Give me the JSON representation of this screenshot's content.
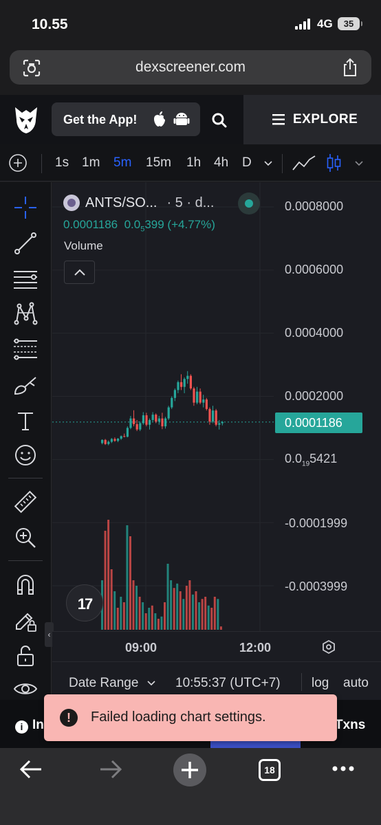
{
  "status_bar": {
    "time": "10.55",
    "network": "4G",
    "battery": "35"
  },
  "browser": {
    "url": "dexscreener.com",
    "tab_count": "18"
  },
  "header": {
    "get_app_label": "Get the App!",
    "explore_label": "EXPLORE"
  },
  "timeframes": {
    "items": [
      "1s",
      "1m",
      "5m",
      "15m",
      "1h",
      "4h",
      "D"
    ],
    "active": "5m"
  },
  "chart": {
    "pair": "ANTS/SO...",
    "meta": "· 5 · d...",
    "last_price": "0.0001186",
    "change_prefix": "0.0",
    "change_sub": "5",
    "change_rest": "399 (+4.77%)",
    "volume_label": "Volume",
    "price_axis": [
      "0.0008000",
      "0.0006000",
      "0.0004000",
      "0.0002000"
    ],
    "current_price_tag": "0.0001186",
    "low_prefix": "0.0",
    "low_sub": "19",
    "low_rest": "5421",
    "neg_axis": [
      "-0.0001999",
      "-0.0003999"
    ],
    "time_labels": [
      "09:00",
      "12:00"
    ],
    "colors": {
      "up": "#26a69a",
      "down": "#ef5350",
      "accent": "#2962ff"
    }
  },
  "bottom_bar": {
    "date_range": "Date Range",
    "clock": "10:55:37 (UTC+7)",
    "log": "log",
    "auto": "auto"
  },
  "info_strip": {
    "left": "In",
    "right": "Txns"
  },
  "toast": {
    "message": "Failed loading chart settings."
  },
  "chart_data": {
    "type": "candlestick",
    "interval": "5m",
    "ylim": [
      -0.0004,
      0.0008
    ],
    "last": 0.0001186,
    "candles": [
      [
        5.2e-05,
        6.4e-05,
        4.8e-05,
        6.2e-05
      ],
      [
        6.2e-05,
        6.5e-05,
        4.6e-05,
        4.9e-05
      ],
      [
        4.9e-05,
        6e-05,
        4.5e-05,
        5.6e-05
      ],
      [
        5.6e-05,
        6.8e-05,
        5.2e-05,
        6.5e-05
      ],
      [
        6.5e-05,
        7e-05,
        5.6e-05,
        5.9e-05
      ],
      [
        5.9e-05,
        6.8e-05,
        5.5e-05,
        6.6e-05
      ],
      [
        6.6e-05,
        7.6e-05,
        6.2e-05,
        7.4e-05
      ],
      [
        7.4e-05,
        8.2e-05,
        7e-05,
        7.2e-05
      ],
      [
        7.2e-05,
        0.000105,
        7e-05,
        0.0001
      ],
      [
        0.0001,
        0.000138,
        9.6e-05,
        0.00013
      ],
      [
        0.00013,
        0.000156,
        0.000105,
        0.000112
      ],
      [
        0.000112,
        0.000125,
        9e-05,
        9.5e-05
      ],
      [
        9.5e-05,
        0.00012,
        9e-05,
        0.000115
      ],
      [
        0.000115,
        0.00015,
        0.00011,
        0.00014
      ],
      [
        0.00014,
        0.000148,
        0.000105,
        0.00011
      ],
      [
        0.00011,
        0.00013,
        9.5e-05,
        0.000125
      ],
      [
        0.000125,
        0.00015,
        0.00012,
        0.000142
      ],
      [
        0.000142,
        0.000146,
        0.000115,
        0.00012
      ],
      [
        0.00012,
        0.000138,
        0.00011,
        0.00013
      ],
      [
        0.00013,
        0.000148,
        9.6e-05,
        0.000105
      ],
      [
        0.000105,
        0.000135,
        9.8e-05,
        0.00013
      ],
      [
        0.00013,
        0.00017,
        0.000125,
        0.000165
      ],
      [
        0.000165,
        0.0002,
        0.00016,
        0.000195
      ],
      [
        0.000195,
        0.000225,
        0.000185,
        0.00022
      ],
      [
        0.00022,
        0.00025,
        0.00021,
        0.000245
      ],
      [
        0.000245,
        0.00027,
        0.00022,
        0.00023
      ],
      [
        0.00023,
        0.00026,
        0.00021,
        0.000255
      ],
      [
        0.000255,
        0.00028,
        0.00024,
        0.000265
      ],
      [
        0.000265,
        0.00027,
        0.00022,
        0.000225
      ],
      [
        0.000225,
        0.00023,
        0.00017,
        0.00018
      ],
      [
        0.00018,
        0.00023,
        0.000175,
        0.000215
      ],
      [
        0.000215,
        0.000225,
        0.000175,
        0.00018
      ],
      [
        0.00018,
        0.000205,
        0.000165,
        0.00019
      ],
      [
        0.00019,
        0.000195,
        0.000155,
        0.00016
      ],
      [
        0.00016,
        0.000165,
        0.00011,
        0.00012
      ],
      [
        0.00012,
        0.00017,
        0.000115,
        0.000155
      ],
      [
        0.000155,
        0.00016,
        0.000105,
        0.00011
      ],
      [
        0.00011,
        0.000125,
        9.5e-05,
        0.000115
      ],
      [
        0.000115,
        0.000122,
        0.000108,
        0.0001186
      ]
    ],
    "volumes": [
      [
        0.45,
        1
      ],
      [
        0.9,
        0
      ],
      [
        1.0,
        0
      ],
      [
        0.55,
        0
      ],
      [
        0.35,
        1
      ],
      [
        0.2,
        0
      ],
      [
        0.3,
        1
      ],
      [
        0.25,
        0
      ],
      [
        0.95,
        1
      ],
      [
        0.85,
        0
      ],
      [
        0.45,
        0
      ],
      [
        0.4,
        1
      ],
      [
        0.3,
        0
      ],
      [
        0.25,
        1
      ],
      [
        0.15,
        0
      ],
      [
        0.2,
        1
      ],
      [
        0.22,
        0
      ],
      [
        0.15,
        1
      ],
      [
        0.1,
        0
      ],
      [
        0.12,
        1
      ],
      [
        0.25,
        0
      ],
      [
        0.6,
        1
      ],
      [
        0.45,
        1
      ],
      [
        0.38,
        0
      ],
      [
        0.42,
        1
      ],
      [
        0.35,
        0
      ],
      [
        0.28,
        1
      ],
      [
        0.4,
        0
      ],
      [
        0.45,
        0
      ],
      [
        0.32,
        1
      ],
      [
        0.35,
        0
      ],
      [
        0.25,
        1
      ],
      [
        0.28,
        0
      ],
      [
        0.3,
        0
      ],
      [
        0.22,
        1
      ],
      [
        0.2,
        0
      ],
      [
        0.3,
        0
      ],
      [
        0.28,
        1
      ],
      [
        0.03,
        0
      ]
    ]
  }
}
